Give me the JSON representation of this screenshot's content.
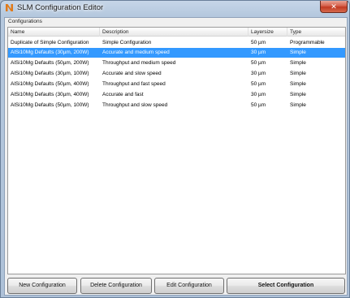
{
  "window": {
    "title": "SLM Configuration Editor",
    "close_glyph": "✕",
    "app_icon": "app-logo-icon",
    "close_icon": "close-icon"
  },
  "group": {
    "label": "Configurations"
  },
  "table": {
    "columns": [
      "Name",
      "Description",
      "Layersize",
      "Type"
    ],
    "selected_index": 1,
    "selected_color": "#3399ff",
    "rows": [
      {
        "name": "Duplicate of Simple Configuration",
        "description": "Simple Configuration",
        "layersize": "50 µm",
        "type": "Programmable"
      },
      {
        "name": "AlSi10Mg Defaults (30µm, 200W)",
        "description": "Accurate and medium speed",
        "layersize": "30 µm",
        "type": "Simple"
      },
      {
        "name": "AlSi10Mg Defaults (50µm, 200W)",
        "description": "Throughput and medium speed",
        "layersize": "50 µm",
        "type": "Simple"
      },
      {
        "name": "AlSi10Mg Defaults (30µm, 100W)",
        "description": "Accurate and slow speed",
        "layersize": "30 µm",
        "type": "Simple"
      },
      {
        "name": "AlSi10Mg Defaults (50µm, 400W)",
        "description": "Throughput and fast speed",
        "layersize": "50 µm",
        "type": "Simple"
      },
      {
        "name": "AlSi10Mg Defaults (30µm, 400W)",
        "description": "Accurate and fast",
        "layersize": "30 µm",
        "type": "Simple"
      },
      {
        "name": "AlSi10Mg Defaults (50µm, 100W)",
        "description": "Throughput and slow speed",
        "layersize": "50 µm",
        "type": "Simple"
      }
    ]
  },
  "buttons": {
    "new": "New Configuration",
    "delete": "Delete Configuration",
    "edit": "Edit Configuration",
    "select": "Select Configuration"
  }
}
